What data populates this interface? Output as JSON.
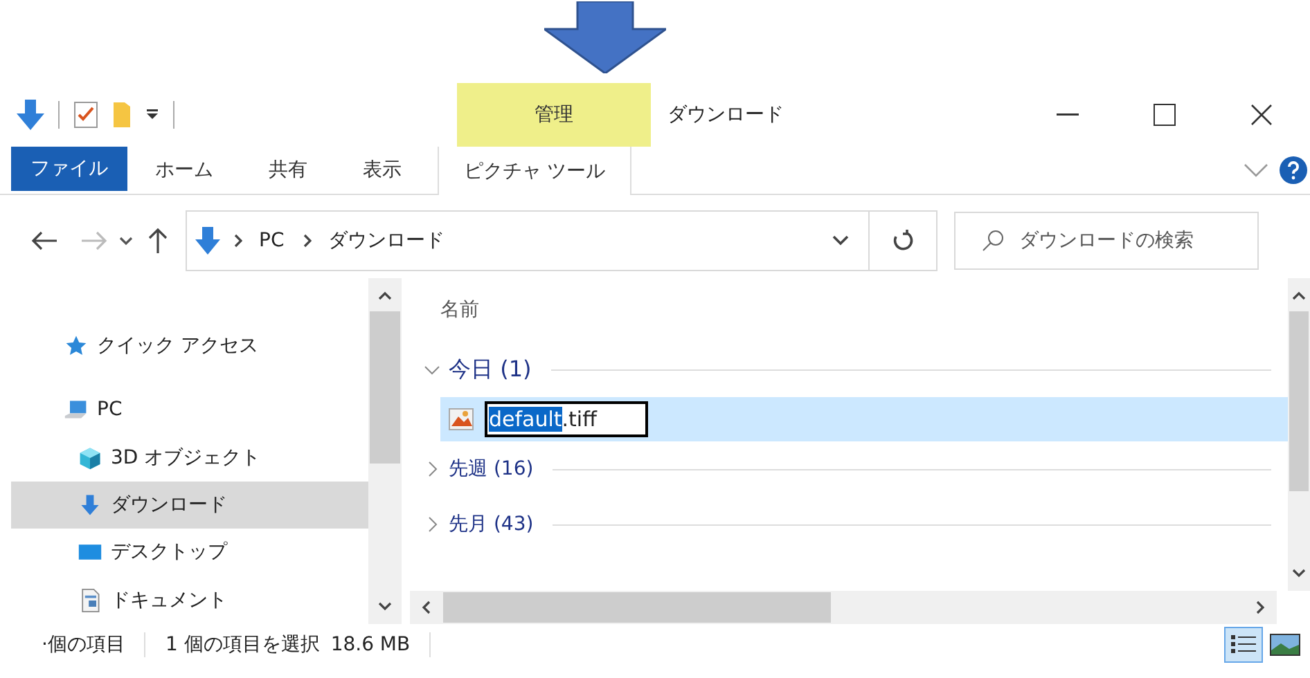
{
  "window": {
    "title": "ダウンロード"
  },
  "contextual_tab": {
    "group": "管理",
    "label": "ピクチャ ツール"
  },
  "ribbon_tabs": [
    {
      "label": "ファイル",
      "kind": "file"
    },
    {
      "label": "ホーム",
      "kind": "tab"
    },
    {
      "label": "共有",
      "kind": "tab"
    },
    {
      "label": "表示",
      "kind": "tab"
    }
  ],
  "address": {
    "path": [
      "PC",
      "ダウンロード"
    ]
  },
  "search": {
    "placeholder": "ダウンロードの検索"
  },
  "nav": [
    {
      "label": "クイック アクセス",
      "kind": "star",
      "selected": false
    },
    {
      "label": "PC",
      "kind": "pc",
      "selected": false,
      "children": [
        {
          "label": "3D オブジェクト",
          "kind": "cube",
          "selected": false
        },
        {
          "label": "ダウンロード",
          "kind": "download",
          "selected": true
        },
        {
          "label": "デスクトップ",
          "kind": "desktop",
          "selected": false
        },
        {
          "label": "ドキュメント",
          "kind": "document",
          "selected": false
        }
      ]
    }
  ],
  "column_header": "名前",
  "groups": [
    {
      "label": "今日 (1)",
      "expanded": true,
      "files": [
        {
          "name": "default",
          "extension": ".tiff",
          "selected": true
        }
      ]
    },
    {
      "label": "先週 (16)",
      "expanded": false
    },
    {
      "label": "先月 (43)",
      "expanded": false
    }
  ],
  "status_bar": {
    "item_count": "·個の項目",
    "selection": "1 個の項目を選択",
    "size": "18.6 MB"
  },
  "view_buttons": [
    {
      "kind": "details",
      "selected": true
    },
    {
      "kind": "large-icons",
      "selected": false
    }
  ]
}
